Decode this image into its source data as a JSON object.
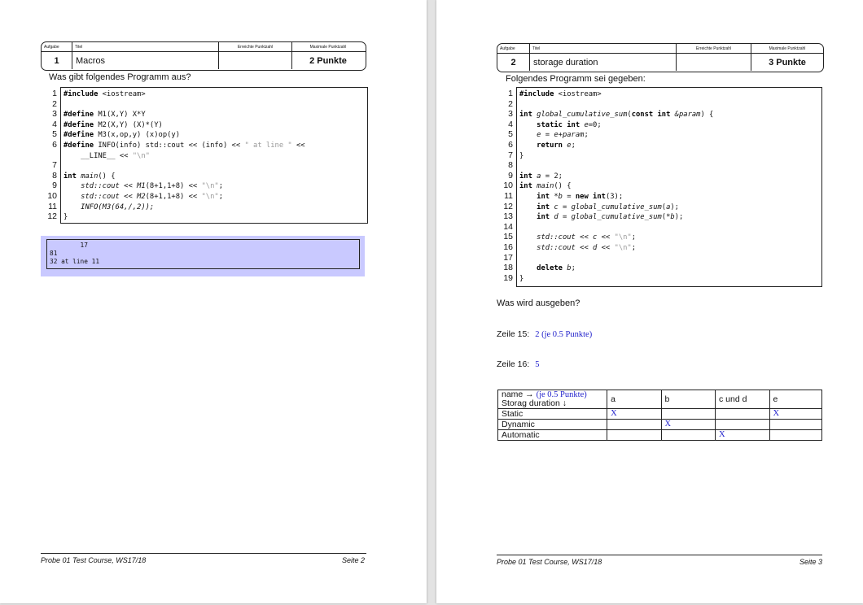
{
  "header_labels": {
    "aufgabe": "Aufgabe",
    "titel": "Titel",
    "erreicht": "Erreichte Punktzahl",
    "maximale": "Maximale Punktzahl"
  },
  "left": {
    "task_number": "1",
    "task_title": "Macros",
    "max_points": "2 Punkte",
    "question": "Was gibt folgendes Programm aus?",
    "line_numbers": [
      "1",
      "2",
      "3",
      "4",
      "5",
      "6",
      "",
      "7",
      "8",
      "9",
      "10",
      "11",
      "12"
    ],
    "output_lines": [
      "        17",
      "81",
      "32 at line 11"
    ],
    "footer_left": "Probe 01 Test Course, WS17/18",
    "footer_right": "Seite 2"
  },
  "right": {
    "task_number": "2",
    "task_title": "storage duration",
    "max_points": "3 Punkte",
    "intro": "Folgendes Programm sei gegeben:",
    "line_numbers": [
      "1",
      "2",
      "3",
      "4",
      "5",
      "6",
      "7",
      "8",
      "9",
      "10",
      "11",
      "12",
      "13",
      "14",
      "15",
      "16",
      "17",
      "18",
      "19"
    ],
    "question": "Was wird ausgeben?",
    "zeile15_label": "Zeile 15:",
    "zeile15_answer": "2 (je 0.5 Punkte)",
    "zeile16_label": "Zeile 16:",
    "zeile16_answer": "5",
    "table": {
      "corner_line1": "name →",
      "corner_note": "(je 0.5 Punkte)",
      "corner_line2": "Storag duration ↓",
      "columns": [
        "a",
        "b",
        "c und d",
        "e"
      ],
      "rows": [
        {
          "label": "Static",
          "marks": [
            "X",
            "",
            "",
            "X"
          ]
        },
        {
          "label": "Dynamic",
          "marks": [
            "",
            "X",
            "",
            ""
          ]
        },
        {
          "label": "Automatic",
          "marks": [
            "",
            "",
            "X",
            ""
          ]
        }
      ]
    },
    "footer_left": "Probe 01 Test Course, WS17/18",
    "footer_right": "Seite 3"
  },
  "code_left": {
    "l1a": "#include",
    "l1b": " <iostream>",
    "l3a": "#define",
    "l3b": " M1(X,Y) X*Y",
    "l4a": "#define",
    "l4b": " M2(X,Y) (X)*(Y)",
    "l5a": "#define",
    "l5b": " M3(x,op,y) (x)op(y)",
    "l6a": "#define",
    "l6b": " INFO(info) std::cout << (info) << ",
    "l6c": "\" at line \"",
    "l6d": " <<",
    "l6e": "    __LINE__ << ",
    "l6f": "\"\\n\"",
    "l8a": "int",
    "l8b": "main",
    "l8c": "() {",
    "l9a": "    std::cout",
    "l9b": " << ",
    "l9c": "M1",
    "l9d": "(8+1,1+8) << ",
    "l9e": "\"\\n\"",
    "l9f": ";",
    "l10a": "    std::cout",
    "l10b": " << ",
    "l10c": "M2",
    "l10d": "(8+1,1+8) << ",
    "l10e": "\"\\n\"",
    "l10f": ";",
    "l11a": "    INFO(M3(64,/,2));",
    "l12a": "}"
  },
  "code_right": {
    "l1a": "#include",
    "l1b": " <iostream>",
    "l3a": "int",
    "l3b": " global_cumulative_sum",
    "l3c": "(",
    "l3d": "const int",
    "l3e": " &param",
    "l3f": ") {",
    "l4a": "    static int",
    "l4b": " e",
    "l4c": "=0;",
    "l5a": "    e",
    "l5b": " = ",
    "l5c": "e",
    "l5d": "+",
    "l5e": "param",
    "l5f": ";",
    "l6a": "    return",
    "l6b": " e",
    "l6c": ";",
    "l7a": "}",
    "l9a": "int",
    "l9b": " a",
    "l9c": " = 2;",
    "l10a": "int",
    "l10b": " main",
    "l10c": "() {",
    "l11a": "    int",
    "l11b": " *b",
    "l11c": " = ",
    "l11d": "new int",
    "l11e": "(3);",
    "l12a": "    int",
    "l12b": " c",
    "l12c": " = ",
    "l12d": "global_cumulative_sum",
    "l12e": "(",
    "l12f": "a",
    "l12g": ");",
    "l13a": "    int",
    "l13b": " d",
    "l13c": " = ",
    "l13d": "global_cumulative_sum",
    "l13e": "(*",
    "l13f": "b",
    "l13g": ");",
    "l15a": "    std::cout",
    "l15b": " << ",
    "l15c": "c",
    "l15d": " << ",
    "l15e": "\"\\n\"",
    "l15f": ";",
    "l16a": "    std::cout",
    "l16b": " << ",
    "l16c": "d",
    "l16d": " << ",
    "l16e": "\"\\n\"",
    "l16f": ";",
    "l18a": "    delete",
    "l18b": " b",
    "l18c": ";",
    "l19a": "}"
  }
}
